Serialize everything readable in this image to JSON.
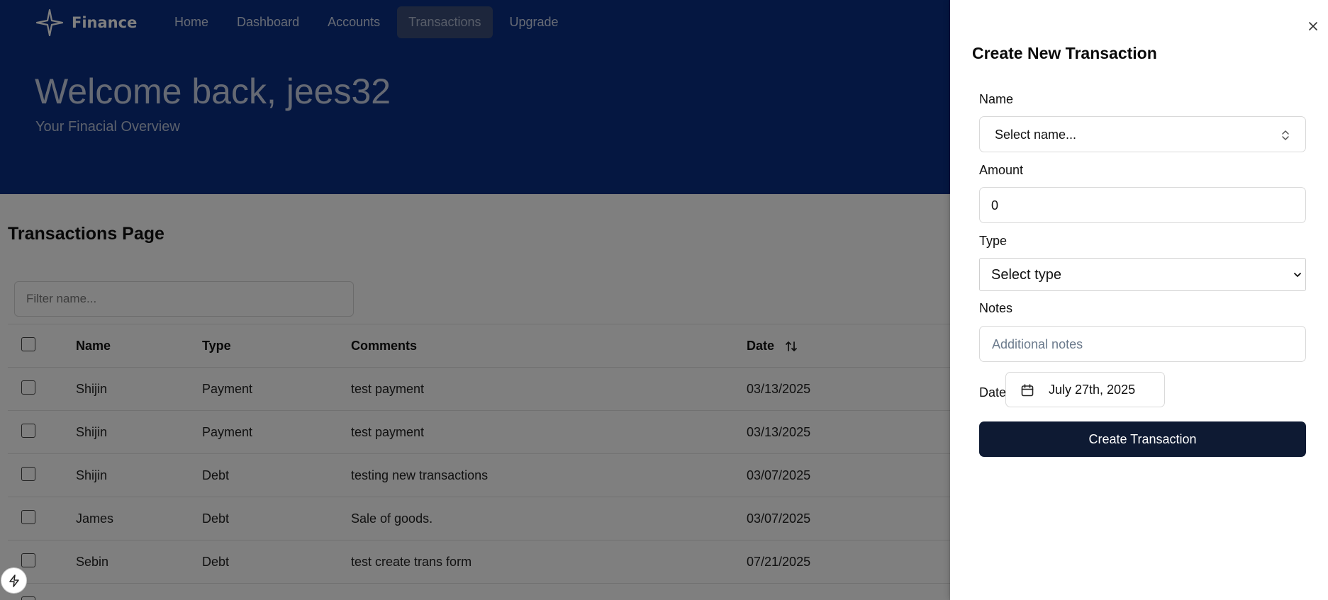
{
  "app": {
    "brand": "Finance",
    "nav": [
      {
        "label": "Home"
      },
      {
        "label": "Dashboard"
      },
      {
        "label": "Accounts"
      },
      {
        "label": "Transactions",
        "active": true
      },
      {
        "label": "Upgrade"
      }
    ],
    "welcome": "Welcome back, jees32",
    "subtitle": "Your Finacial Overview",
    "colors": {
      "hero": "#0a2e82",
      "overlay": "rgba(0,0,0,0.5)",
      "primary_button": "#0e1a33"
    }
  },
  "transactions": {
    "page_title": "Transactions Page",
    "filter_placeholder": "Filter name...",
    "columns": {
      "name": "Name",
      "type": "Type",
      "comments": "Comments",
      "date": "Date"
    },
    "rows": [
      {
        "name": "Shijin",
        "type": "Payment",
        "comments": "test payment",
        "date": "03/13/2025"
      },
      {
        "name": "Shijin",
        "type": "Payment",
        "comments": "test payment",
        "date": "03/13/2025"
      },
      {
        "name": "Shijin",
        "type": "Debt",
        "comments": "testing new transactions",
        "date": "03/07/2025"
      },
      {
        "name": "James",
        "type": "Debt",
        "comments": "Sale of goods.",
        "date": "03/07/2025"
      },
      {
        "name": "Sebin",
        "type": "Debt",
        "comments": "test create trans form",
        "date": "07/21/2025"
      }
    ]
  },
  "drawer": {
    "title": "Create New Transaction",
    "name_label": "Name",
    "name_placeholder": "Select name...",
    "amount_label": "Amount",
    "amount_value": "0",
    "type_label": "Type",
    "type_selected": "Select type",
    "notes_label": "Notes",
    "notes_placeholder": "Additional notes",
    "date_label": "Date",
    "date_value": "July 27th, 2025",
    "submit_label": "Create Transaction"
  },
  "icons": {
    "logo": "sparkle-star-icon",
    "sort": "arrow-up-down-icon",
    "close": "close-icon",
    "name_select": "chevrons-up-down-icon",
    "type_select": "chevron-down-icon",
    "date": "calendar-icon",
    "floating": "lightning-bolt-icon"
  }
}
